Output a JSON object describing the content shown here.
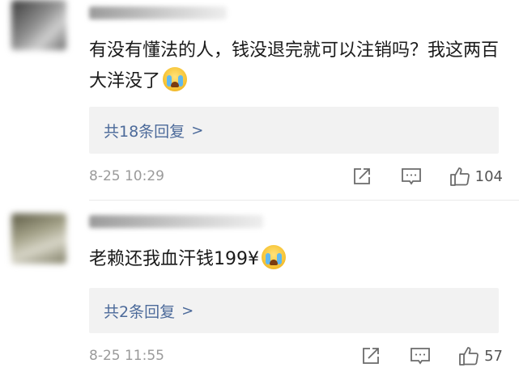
{
  "comments": [
    {
      "text": "有没有懂法的人，钱没退完就可以注销吗？我这两百大洋没了",
      "emoji": "crying-face-icon",
      "replies_label": "共18条回复",
      "replies_arrow": ">",
      "timestamp": "8-25 10:29",
      "like_count": "104"
    },
    {
      "text": "老赖还我血汗钱199¥",
      "emoji": "crying-face-icon",
      "replies_label": "共2条回复",
      "replies_arrow": ">",
      "timestamp": "8-25 11:55",
      "like_count": "57"
    }
  ],
  "colors": {
    "reply_link": "#4c6a9a",
    "reply_box_bg": "#f2f2f2",
    "meta_text": "#9a9a9a",
    "icon": "#6b6b6b"
  }
}
